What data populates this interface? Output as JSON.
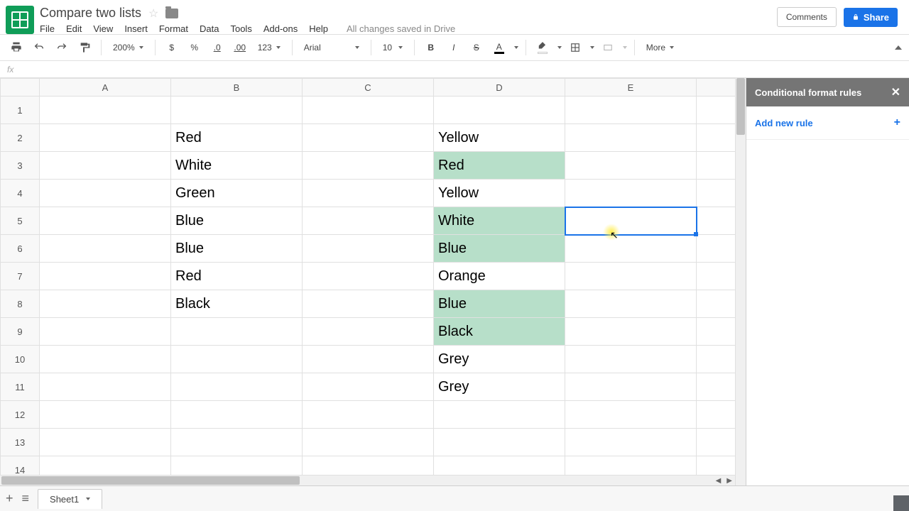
{
  "doc_title": "Compare two lists",
  "menu": {
    "file": "File",
    "edit": "Edit",
    "view": "View",
    "insert": "Insert",
    "format": "Format",
    "data": "Data",
    "tools": "Tools",
    "addons": "Add-ons",
    "help": "Help"
  },
  "saved_status": "All changes saved in Drive",
  "buttons": {
    "comments": "Comments",
    "share": "Share"
  },
  "toolbar": {
    "zoom": "200%",
    "font_name": "Arial",
    "font_size": "10",
    "decimal_dec": ".0",
    "decimal_inc": ".00",
    "num_format": "123",
    "more": "More"
  },
  "formula_bar_label": "fx",
  "columns": [
    "A",
    "B",
    "C",
    "D",
    "E"
  ],
  "row_count": 14,
  "cells": {
    "B": {
      "2": "Red",
      "3": "White",
      "4": "Green",
      "5": "Blue",
      "6": "Blue",
      "7": "Red",
      "8": "Black"
    },
    "D": {
      "2": "Yellow",
      "3": "Red",
      "4": "Yellow",
      "5": "White",
      "6": "Blue",
      "7": "Orange",
      "8": "Blue",
      "9": "Black",
      "10": "Grey",
      "11": "Grey"
    }
  },
  "highlighted": {
    "D": [
      3,
      5,
      6,
      8,
      9
    ]
  },
  "selected_cell": "E5",
  "side_panel": {
    "title": "Conditional format rules",
    "add_rule": "Add new rule"
  },
  "sheet_tab": "Sheet1",
  "highlight_color": "#b7dfc9",
  "chart_data": null
}
